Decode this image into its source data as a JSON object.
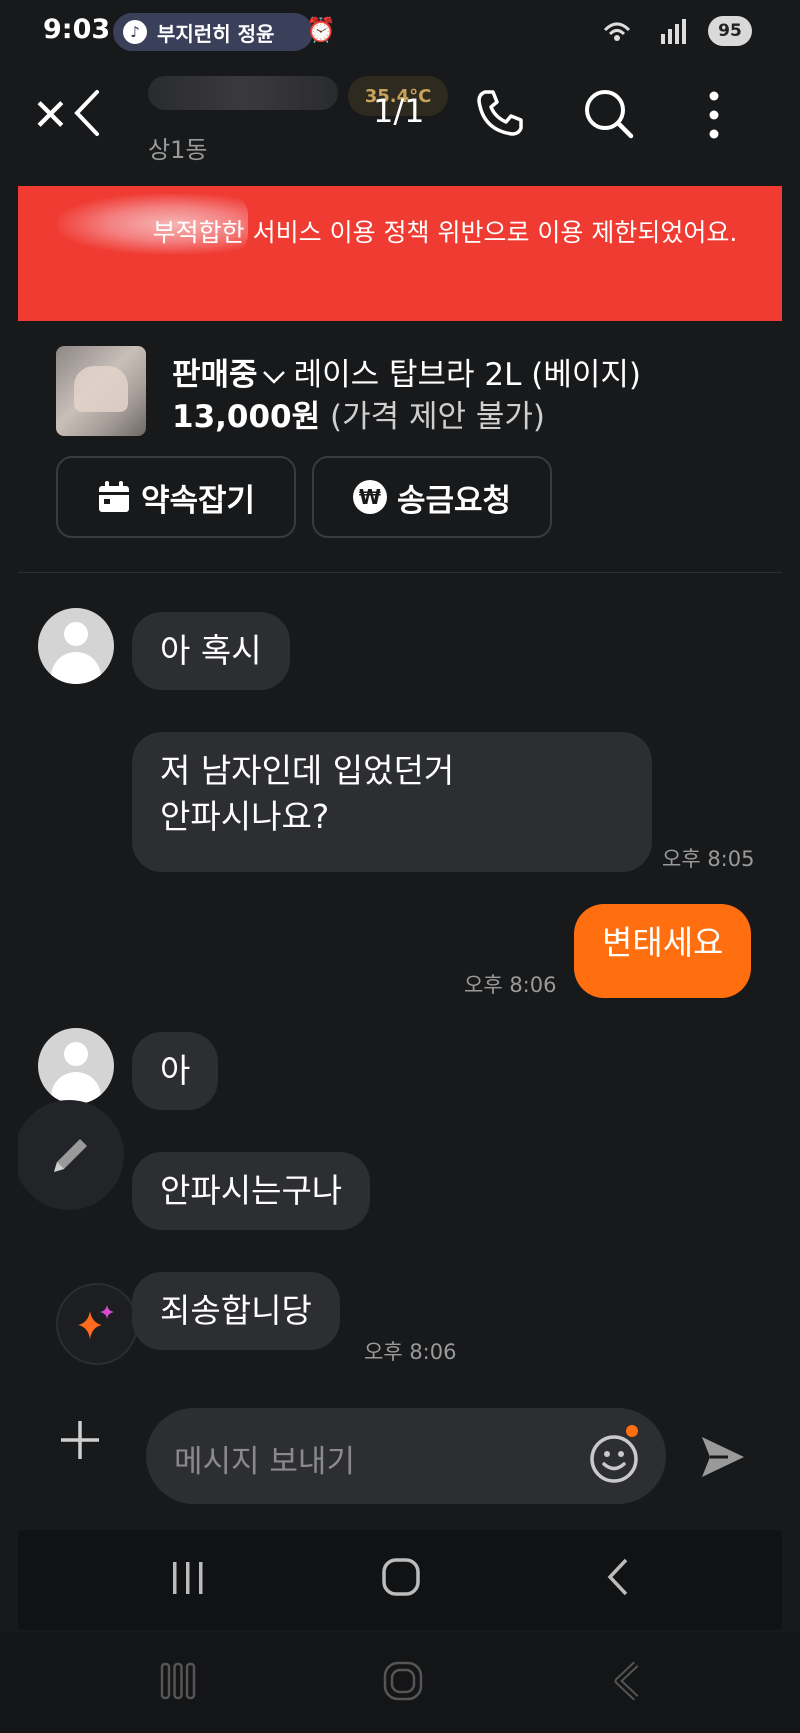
{
  "status_bar": {
    "time": "9:03",
    "media_text": "부지런히 정윤",
    "battery": "95"
  },
  "header": {
    "close_glyph": "✕",
    "temperature": "35.4°C",
    "counter": "1/1",
    "location": "상1동"
  },
  "banner": {
    "text": "부적합한 서비스 이용 정책 위반으로 이용 제한되었어요."
  },
  "product": {
    "status": "판매중",
    "title": "레이스 탑브라 2L (베이지)",
    "price": "13,000원",
    "price_note": "(가격 제안 불가)",
    "appointment_button": "약속잡기",
    "payment_button": "송금요청"
  },
  "messages": [
    {
      "side": "them",
      "text": "아 혹시",
      "time": ""
    },
    {
      "side": "them",
      "text": "저 남자인데 입었던거\n안파시나요?",
      "time": "오후 8:05"
    },
    {
      "side": "me",
      "text": "변태세요",
      "time": "오후 8:06"
    },
    {
      "side": "them",
      "text": "아",
      "time": ""
    },
    {
      "side": "them",
      "text": "안파시는구나",
      "time": ""
    },
    {
      "side": "them",
      "text": "죄송합니당",
      "time": "오후 8:06"
    }
  ],
  "input": {
    "placeholder": "메시지 보내기"
  },
  "colors": {
    "background": "#18191b",
    "bubble_them": "#2d2e31",
    "bubble_me": "#ff6f0f",
    "banner": "#f03b32"
  },
  "icons": [
    "close-icon",
    "back-icon",
    "phone-icon",
    "search-icon",
    "more-icon",
    "calendar-icon",
    "won-icon",
    "pencil-icon",
    "sparkle-icon",
    "plus-icon",
    "emoji-icon",
    "send-icon",
    "recents-icon",
    "home-icon",
    "back-nav-icon"
  ]
}
